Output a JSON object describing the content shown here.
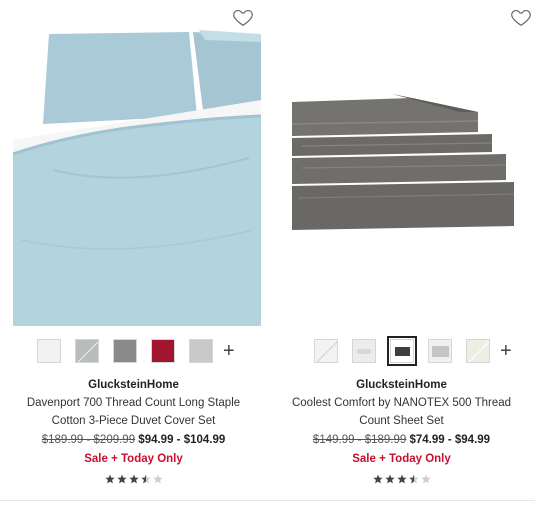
{
  "products": [
    {
      "brand": "GlucksteinHome",
      "title": "Davenport 700 Thread Count Long Staple Cotton 3-Piece Duvet Cover Set",
      "price_was": "$189.99 - $209.99",
      "price_now": "$94.99 - $104.99",
      "promo": "Sale + Today Only",
      "rating": 3.5,
      "more_label": "+",
      "swatches": [
        {
          "name": "white",
          "color": "#f2f2f2"
        },
        {
          "name": "sage",
          "color": "#b9bdb9"
        },
        {
          "name": "grey",
          "color": "#8a8a8a"
        },
        {
          "name": "red",
          "color": "#a1162e"
        },
        {
          "name": "silver",
          "color": "#c9c9c9"
        }
      ],
      "image_colors": {
        "fabric": "#b3d3df",
        "sheet": "#f4f5f4"
      }
    },
    {
      "brand": "GlucksteinHome",
      "title": "Coolest Comfort by NANOTEX 500 Thread Count Sheet Set",
      "price_was": "$149.99 - $189.99",
      "price_now": "$74.99 - $94.99",
      "promo": "Sale + Today Only",
      "rating": 3.5,
      "more_label": "+",
      "swatches": [
        {
          "name": "white",
          "color": "#f3f3f3"
        },
        {
          "name": "light-grey",
          "color": "#d8d8d8"
        },
        {
          "name": "charcoal",
          "color": "#3f3f3f",
          "selected": true
        },
        {
          "name": "stone",
          "color": "#c4c6c4"
        },
        {
          "name": "ivory",
          "color": "#efeee4"
        }
      ],
      "image_colors": {
        "fabric": "#6f6d69"
      }
    }
  ]
}
